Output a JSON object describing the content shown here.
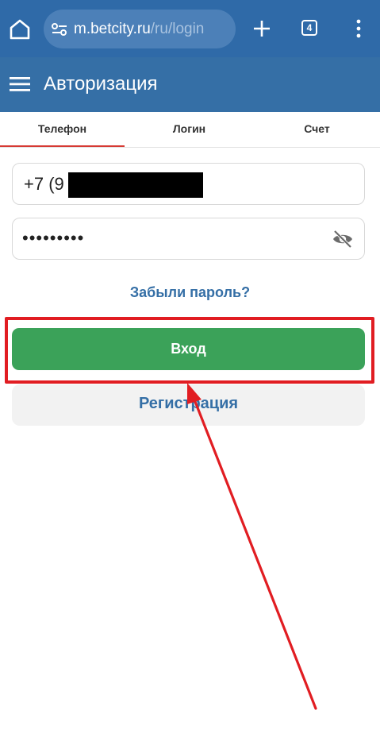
{
  "browser": {
    "url_host": "m.betcity.ru",
    "url_path": "/ru/login",
    "tab_count": "4"
  },
  "header": {
    "title": "Авторизация"
  },
  "tabs": [
    {
      "label": "Телефон",
      "active": true
    },
    {
      "label": "Логин",
      "active": false
    },
    {
      "label": "Счет",
      "active": false
    }
  ],
  "form": {
    "phone_value": "+7 (9",
    "password_value": "•••••••••",
    "forgot_link": "Забыли пароль?",
    "login_button": "Вход",
    "register_button": "Регистрация"
  },
  "colors": {
    "browser_bar": "#2f6aa8",
    "header": "#356fa6",
    "accent_green": "#3ba259",
    "link_blue": "#356fa6",
    "annotation_red": "#e11d22"
  },
  "icons": [
    "home-icon",
    "site-settings-icon",
    "plus-icon",
    "tab-switcher-icon",
    "more-vert-icon",
    "hamburger-icon",
    "eye-off-icon"
  ]
}
